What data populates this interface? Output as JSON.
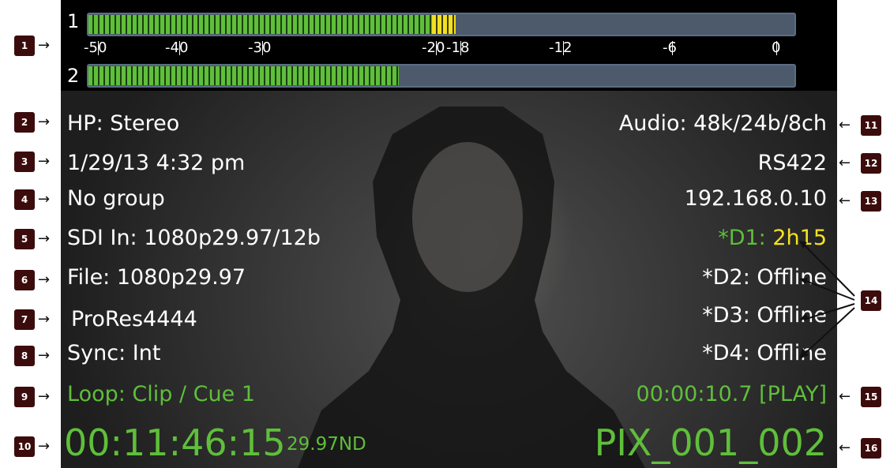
{
  "meters": {
    "ch1": {
      "label": "1",
      "level_fraction": 0.52,
      "peak_fraction": 0.0
    },
    "ch2": {
      "label": "2",
      "level_fraction": 0.44
    },
    "scale": [
      "-50",
      "-40",
      "-30",
      "-20",
      "-18",
      "-12",
      "-6",
      "0"
    ]
  },
  "left_status": {
    "headphone": "HP: Stereo",
    "datetime": "1/29/13 4:32 pm",
    "group": "No group",
    "sdi_in": "SDI In: 1080p29.97/12b",
    "file_format": "File: 1080p29.97",
    "codec": "ProRes4444",
    "sync": "Sync: Int",
    "loop": "Loop: Clip / Cue 1",
    "timecode": "00:11:46:15",
    "framerate": "29.97ND"
  },
  "right_status": {
    "audio": "Audio: 48k/24b/8ch",
    "remote": "RS422",
    "ip": "192.168.0.10",
    "d1_prefix": "*D1: ",
    "d1_value": "2h15",
    "d2": "*D2: Offline",
    "d3": "*D3: Offline",
    "d4": "*D4: Offline",
    "clip_time": "00:00:10.7 [PLAY]",
    "clip_name": "PIX_001_002"
  },
  "callouts": [
    "1",
    "2",
    "3",
    "4",
    "5",
    "6",
    "7",
    "8",
    "9",
    "10",
    "11",
    "12",
    "13",
    "14",
    "15",
    "16"
  ],
  "colors": {
    "meter_green": "#5fbf3a",
    "meter_yellow": "#f0e020",
    "meter_bg": "#4d5a6c",
    "status_green": "#5fbf3a",
    "status_yellow": "#f5e21e",
    "callout_bg": "#3c0c0c"
  }
}
